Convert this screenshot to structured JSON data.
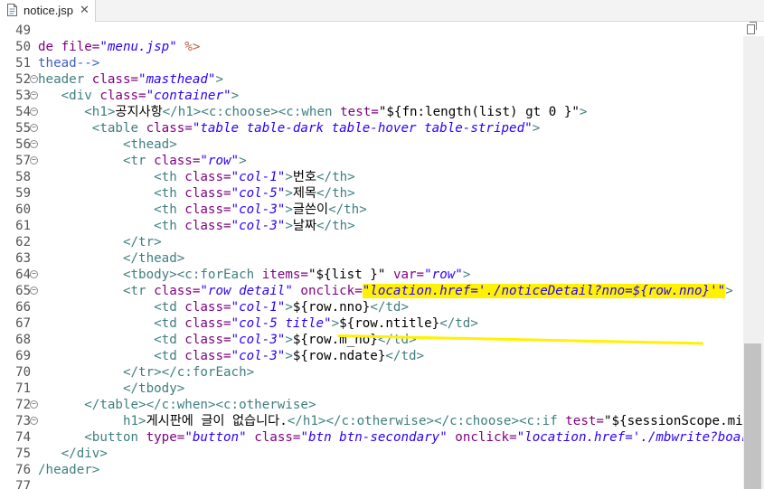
{
  "tab": {
    "label": "notice.jsp",
    "close": "✕"
  },
  "editor": {
    "lines": [
      {
        "n": "49",
        "fold": "",
        "segments": []
      },
      {
        "n": "50",
        "fold": "",
        "segments": [
          {
            "t": "de ",
            "c": "at"
          },
          {
            "t": "file=",
            "c": "at"
          },
          {
            "t": "\"menu.jsp\"",
            "c": "vl"
          },
          {
            "t": " %>",
            "c": "jsp"
          }
        ]
      },
      {
        "n": "51",
        "fold": "",
        "segments": [
          {
            "t": "thead-->",
            "c": "cm"
          }
        ]
      },
      {
        "n": "52",
        "fold": "⊖",
        "segments": [
          {
            "t": "header ",
            "c": "tg"
          },
          {
            "t": "class=",
            "c": "at"
          },
          {
            "t": "\"masthead\"",
            "c": "vl"
          },
          {
            "t": ">",
            "c": "tg"
          }
        ]
      },
      {
        "n": "53",
        "fold": "⊖",
        "segments": [
          {
            "t": "   <div ",
            "c": "tg"
          },
          {
            "t": "class=",
            "c": "at"
          },
          {
            "t": "\"container\"",
            "c": "vl"
          },
          {
            "t": ">",
            "c": "tg"
          }
        ]
      },
      {
        "n": "54",
        "fold": "⊖",
        "segments": [
          {
            "t": "      <h1>",
            "c": "tg"
          },
          {
            "t": "공지사항",
            "c": "kw"
          },
          {
            "t": "</h1><c:choose><c:when ",
            "c": "tg"
          },
          {
            "t": "test=",
            "c": "at"
          },
          {
            "t": "\"${fn:length(list) gt 0 }\"",
            "c": "kw"
          },
          {
            "t": ">",
            "c": "tg"
          }
        ]
      },
      {
        "n": "55",
        "fold": "⊖",
        "segments": [
          {
            "t": "       <table ",
            "c": "tg"
          },
          {
            "t": "class=",
            "c": "at"
          },
          {
            "t": "\"table table-dark table-hover table-striped\"",
            "c": "vl"
          },
          {
            "t": ">",
            "c": "tg"
          }
        ]
      },
      {
        "n": "56",
        "fold": "⊖",
        "segments": [
          {
            "t": "           <thead>",
            "c": "tg"
          }
        ]
      },
      {
        "n": "57",
        "fold": "⊖",
        "segments": [
          {
            "t": "           <tr ",
            "c": "tg"
          },
          {
            "t": "class=",
            "c": "at"
          },
          {
            "t": "\"row\"",
            "c": "vl"
          },
          {
            "t": ">",
            "c": "tg"
          }
        ]
      },
      {
        "n": "58",
        "fold": "",
        "segments": [
          {
            "t": "               <th ",
            "c": "tg"
          },
          {
            "t": "class=",
            "c": "at"
          },
          {
            "t": "\"col-1\"",
            "c": "vl"
          },
          {
            "t": ">",
            "c": "tg"
          },
          {
            "t": "번호",
            "c": "kw"
          },
          {
            "t": "</th>",
            "c": "tg"
          }
        ]
      },
      {
        "n": "59",
        "fold": "",
        "segments": [
          {
            "t": "               <th ",
            "c": "tg"
          },
          {
            "t": "class=",
            "c": "at"
          },
          {
            "t": "\"col-5\"",
            "c": "vl"
          },
          {
            "t": ">",
            "c": "tg"
          },
          {
            "t": "제목",
            "c": "kw"
          },
          {
            "t": "</th>",
            "c": "tg"
          }
        ]
      },
      {
        "n": "60",
        "fold": "",
        "segments": [
          {
            "t": "               <th ",
            "c": "tg"
          },
          {
            "t": "class=",
            "c": "at"
          },
          {
            "t": "\"col-3\"",
            "c": "vl"
          },
          {
            "t": ">",
            "c": "tg"
          },
          {
            "t": "글쓴이",
            "c": "kw"
          },
          {
            "t": "</th>",
            "c": "tg"
          }
        ]
      },
      {
        "n": "61",
        "fold": "",
        "segments": [
          {
            "t": "               <th ",
            "c": "tg"
          },
          {
            "t": "class=",
            "c": "at"
          },
          {
            "t": "\"col-3\"",
            "c": "vl"
          },
          {
            "t": ">",
            "c": "tg"
          },
          {
            "t": "날짜",
            "c": "kw"
          },
          {
            "t": "</th>",
            "c": "tg"
          }
        ]
      },
      {
        "n": "62",
        "fold": "",
        "segments": [
          {
            "t": "           </tr>",
            "c": "tg"
          }
        ]
      },
      {
        "n": "63",
        "fold": "",
        "segments": [
          {
            "t": "           </thead>",
            "c": "tg"
          }
        ]
      },
      {
        "n": "64",
        "fold": "⊖",
        "segments": [
          {
            "t": "           <tbody><c:forEach ",
            "c": "tg"
          },
          {
            "t": "items=",
            "c": "at"
          },
          {
            "t": "\"${list }\"",
            "c": "kw"
          },
          {
            "t": " ",
            "c": "kw"
          },
          {
            "t": "var=",
            "c": "at"
          },
          {
            "t": "\"row\"",
            "c": "vl"
          },
          {
            "t": ">",
            "c": "tg"
          }
        ]
      },
      {
        "n": "65",
        "fold": "⊖",
        "segments": [
          {
            "t": "           <tr ",
            "c": "tg"
          },
          {
            "t": "class=",
            "c": "at"
          },
          {
            "t": "\"row detail\"",
            "c": "vl"
          },
          {
            "t": " ",
            "c": "kw"
          },
          {
            "t": "onclick=",
            "c": "at"
          },
          {
            "t": "\"location.href='./noticeDetail?nno=${row.nno}'\"",
            "c": "vl",
            "hl": true
          },
          {
            "t": ">",
            "c": "tg"
          }
        ]
      },
      {
        "n": "66",
        "fold": "",
        "segments": [
          {
            "t": "               <td ",
            "c": "tg"
          },
          {
            "t": "class=",
            "c": "at"
          },
          {
            "t": "\"col-1\"",
            "c": "vl"
          },
          {
            "t": ">",
            "c": "tg"
          },
          {
            "t": "${row.nno}",
            "c": "kw"
          },
          {
            "t": "</td>",
            "c": "tg"
          }
        ]
      },
      {
        "n": "67",
        "fold": "",
        "segments": [
          {
            "t": "               <td ",
            "c": "tg"
          },
          {
            "t": "class=",
            "c": "at"
          },
          {
            "t": "\"col-5 title\"",
            "c": "vl"
          },
          {
            "t": ">",
            "c": "tg"
          },
          {
            "t": "${row.ntitle}",
            "c": "kw"
          },
          {
            "t": "</td>",
            "c": "tg"
          }
        ]
      },
      {
        "n": "68",
        "fold": "",
        "segments": [
          {
            "t": "               <td ",
            "c": "tg"
          },
          {
            "t": "class=",
            "c": "at"
          },
          {
            "t": "\"col-3\"",
            "c": "vl"
          },
          {
            "t": ">",
            "c": "tg"
          },
          {
            "t": "${row.m_no}",
            "c": "kw"
          },
          {
            "t": "</td>",
            "c": "tg"
          }
        ]
      },
      {
        "n": "69",
        "fold": "",
        "segments": [
          {
            "t": "               <td ",
            "c": "tg"
          },
          {
            "t": "class=",
            "c": "at"
          },
          {
            "t": "\"col-3\"",
            "c": "vl"
          },
          {
            "t": ">",
            "c": "tg"
          },
          {
            "t": "${row.ndate}",
            "c": "kw"
          },
          {
            "t": "</td>",
            "c": "tg"
          }
        ]
      },
      {
        "n": "70",
        "fold": "",
        "segments": [
          {
            "t": "           </tr></c:forEach>",
            "c": "tg"
          }
        ]
      },
      {
        "n": "71",
        "fold": "",
        "segments": [
          {
            "t": "           </tbody>",
            "c": "tg"
          }
        ]
      },
      {
        "n": "72",
        "fold": "⊖",
        "segments": [
          {
            "t": "      </table></c:when><c:otherwise>",
            "c": "tg"
          }
        ]
      },
      {
        "n": "73",
        "fold": "⊖",
        "segments": [
          {
            "t": "           h1>",
            "c": "tg"
          },
          {
            "t": "게시판에 글이 없습니다.",
            "c": "kw"
          },
          {
            "t": "</h1></c:otherwise></c:choose><c:if ",
            "c": "tg"
          },
          {
            "t": "test=",
            "c": "at"
          },
          {
            "t": "\"${sessionScope.mid",
            "c": "kw"
          }
        ]
      },
      {
        "n": "74",
        "fold": "",
        "segments": [
          {
            "t": "      <button ",
            "c": "tg"
          },
          {
            "t": "type=",
            "c": "at"
          },
          {
            "t": "\"button\"",
            "c": "vl"
          },
          {
            "t": " ",
            "c": "kw"
          },
          {
            "t": "class=",
            "c": "at"
          },
          {
            "t": "\"btn btn-secondary\"",
            "c": "vl"
          },
          {
            "t": " ",
            "c": "kw"
          },
          {
            "t": "onclick=",
            "c": "at"
          },
          {
            "t": "\"location.href='./mbwrite?board=${pa",
            "c": "vl"
          }
        ]
      },
      {
        "n": "75",
        "fold": "",
        "segments": [
          {
            "t": "   </div>",
            "c": "tg"
          }
        ]
      },
      {
        "n": "76",
        "fold": "",
        "segments": [
          {
            "t": "/header>",
            "c": "tg"
          }
        ]
      },
      {
        "n": "77",
        "fold": "",
        "segments": []
      }
    ]
  },
  "colors": {
    "highlight": "#fff200",
    "tag": "#3f7f7f",
    "attr": "#7f007f",
    "value": "#2a00ff"
  }
}
